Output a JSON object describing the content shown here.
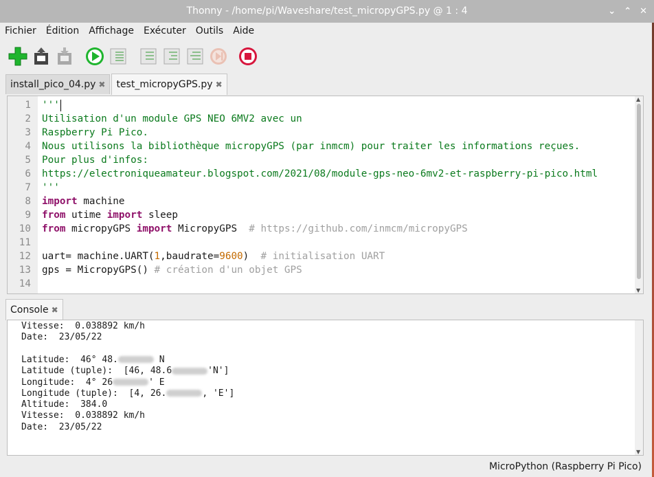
{
  "window": {
    "title": "Thonny  -  /home/pi/Waveshare/test_micropyGPS.py  @  1 : 4",
    "controls": [
      "✕",
      "⌃",
      "⌄"
    ]
  },
  "menu": [
    "Fichier",
    "Édition",
    "Affichage",
    "Exécuter",
    "Outils",
    "Aide"
  ],
  "toolbar": {
    "icons": [
      "new-file-icon",
      "load-file-icon",
      "save-file-icon",
      "run-icon",
      "debug-icon",
      "step-over-icon",
      "step-into-icon",
      "step-out-icon",
      "resume-icon",
      "stop-icon"
    ],
    "colors": {
      "green": "#1fb52e",
      "red": "#d7163d",
      "disabled": "#9a9a9a"
    }
  },
  "tabs": [
    {
      "label": "install_pico_04.py",
      "close": "✖"
    },
    {
      "label": "test_micropyGPS.py",
      "close": "✖"
    }
  ],
  "editor": {
    "line_numbers": [
      "1",
      "2",
      "3",
      "4",
      "5",
      "6",
      "7",
      "8",
      "9",
      "10",
      "11",
      "12",
      "13",
      "14"
    ],
    "code": [
      [
        {
          "t": "'''",
          "c": "str"
        }
      ],
      [
        {
          "t": "Utilisation d'un module GPS NEO 6MV2 avec un",
          "c": "str"
        }
      ],
      [
        {
          "t": "Raspberry Pi Pico.",
          "c": "str"
        }
      ],
      [
        {
          "t": "Nous utilisons la bibliothèque micropyGPS (par inmcm) pour traiter les informations reçues.",
          "c": "str"
        }
      ],
      [
        {
          "t": "Pour plus d'infos:",
          "c": "str"
        }
      ],
      [
        {
          "t": "https://electroniqueamateur.blogspot.com/2021/08/module-gps-neo-6mv2-et-raspberry-pi-pico.html",
          "c": "str"
        }
      ],
      [
        {
          "t": "'''",
          "c": "str"
        }
      ],
      [
        {
          "t": "import",
          "c": "kw"
        },
        {
          "t": " machine",
          "c": ""
        }
      ],
      [
        {
          "t": "from",
          "c": "kw"
        },
        {
          "t": " utime ",
          "c": ""
        },
        {
          "t": "import",
          "c": "kw"
        },
        {
          "t": " sleep",
          "c": ""
        }
      ],
      [
        {
          "t": "from",
          "c": "kw"
        },
        {
          "t": " micropyGPS ",
          "c": ""
        },
        {
          "t": "import",
          "c": "kw"
        },
        {
          "t": " MicropyGPS  ",
          "c": ""
        },
        {
          "t": "# https://github.com/inmcm/micropyGPS",
          "c": "cm"
        }
      ],
      [],
      [
        {
          "t": "uart= machine.UART(",
          "c": ""
        },
        {
          "t": "1",
          "c": "num"
        },
        {
          "t": ",baudrate=",
          "c": ""
        },
        {
          "t": "9600",
          "c": "num"
        },
        {
          "t": ")  ",
          "c": ""
        },
        {
          "t": "# initialisation UART",
          "c": "cm"
        }
      ],
      [
        {
          "t": "gps = MicropyGPS() ",
          "c": ""
        },
        {
          "t": "# création d'un objet GPS",
          "c": "cm"
        }
      ],
      []
    ]
  },
  "console": {
    "tab_label": "Console",
    "close": "✖",
    "lines": [
      [
        "Vitesse:  0.038892 km/h"
      ],
      [
        "Date:  23/05/22"
      ],
      [
        ""
      ],
      [
        "Latitude:  46° 48.",
        "#",
        " N"
      ],
      [
        "Latitude (tuple):  [46, 48.6",
        "#",
        "'N']"
      ],
      [
        "Longitude:  4° 26",
        "#",
        "' E"
      ],
      [
        "Longitude (tuple):  [4, 26.",
        "#",
        ", 'E']"
      ],
      [
        "Altitude:  384.0"
      ],
      [
        "Vitesse:  0.038892 km/h"
      ],
      [
        "Date:  23/05/22"
      ]
    ]
  },
  "status": "MicroPython (Raspberry Pi Pico)"
}
